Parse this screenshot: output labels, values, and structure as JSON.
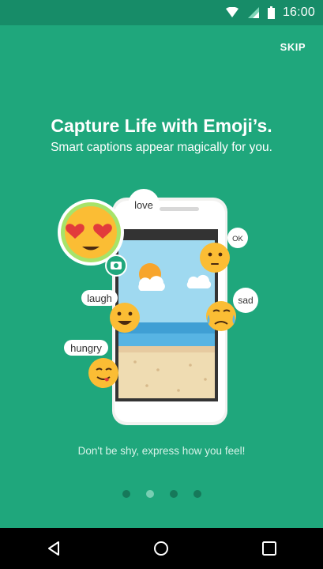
{
  "status_bar": {
    "time": "16:00",
    "icons": [
      "wifi-icon",
      "signal-icon",
      "battery-icon"
    ]
  },
  "header": {
    "skip_label": "SKIP"
  },
  "onboarding": {
    "title": "Capture Life with Emoji’s.",
    "subtitle": "Smart captions appear magically for you.",
    "caption": "Don't be shy, express how you feel!"
  },
  "illustration": {
    "tags": {
      "love": "love",
      "ok": "OK",
      "laugh": "laugh",
      "sad": "sad",
      "hungry": "hungry"
    }
  },
  "pager": {
    "count": 4,
    "active_index": 1
  },
  "nav_bar": {
    "buttons": [
      "back-icon",
      "home-icon",
      "recents-icon"
    ]
  },
  "colors": {
    "background": "#1fa77c",
    "status_bar": "#178c68",
    "emoji": "#fbbd34",
    "nav_bar": "#000000"
  }
}
